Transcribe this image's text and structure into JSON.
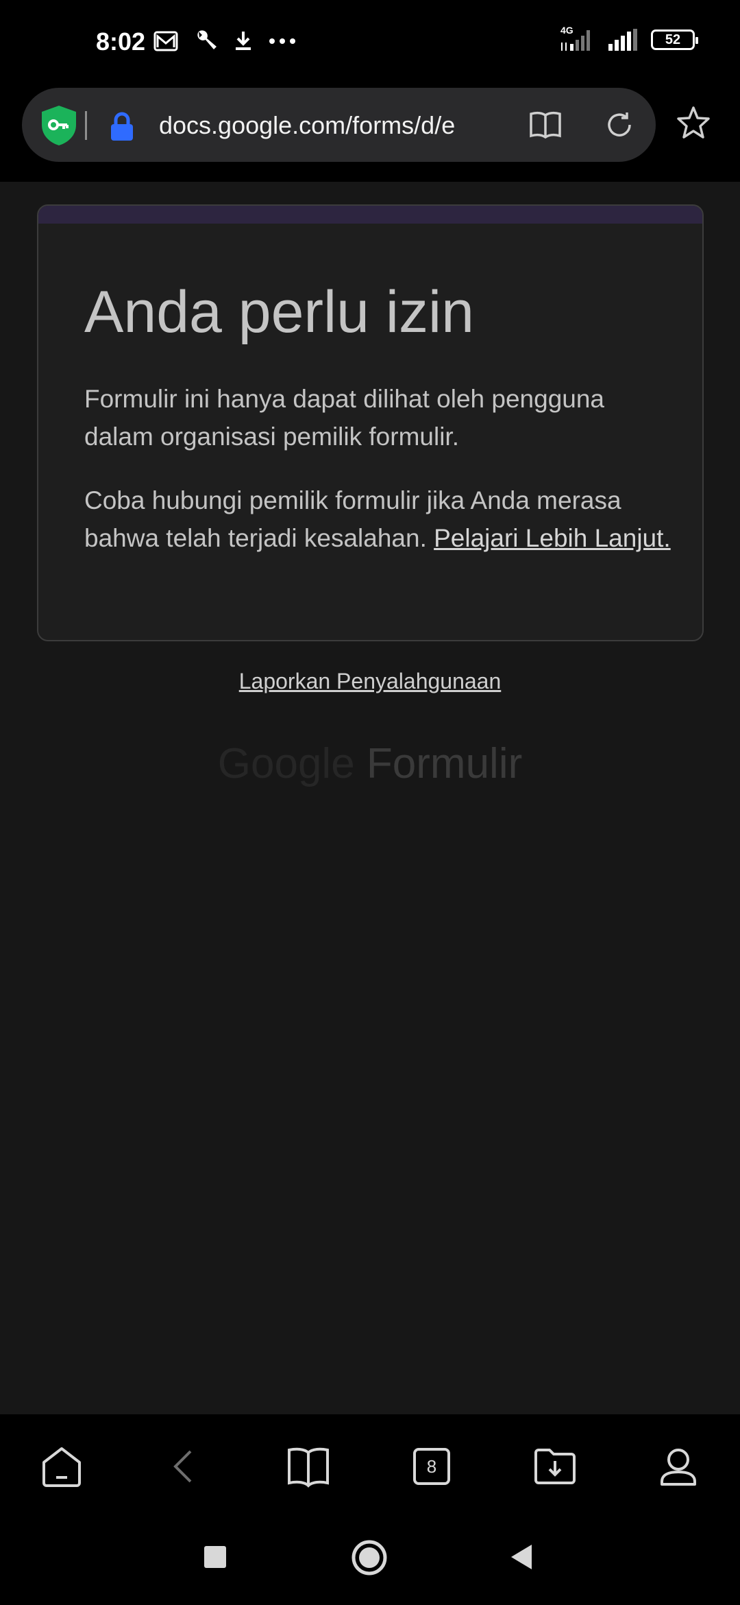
{
  "status_bar": {
    "time": "8:02",
    "network_label": "4G",
    "battery": "52"
  },
  "browser": {
    "url": "docs.google.com/forms/d/e"
  },
  "card": {
    "title": "Anda perlu izin",
    "paragraph1": "Formulir ini hanya dapat dilihat oleh pengguna dalam organisasi pemilik formulir.",
    "paragraph2": "Coba hubungi pemilik formulir jika Anda merasa bahwa telah terjadi kesalahan.",
    "learn_more": "Pelajari Lebih Lanjut."
  },
  "report_abuse": "Laporkan Penyalahgunaan",
  "brand": {
    "google": "Google",
    "product": "Formulir"
  },
  "bottom_nav": {
    "tab_count": "8"
  },
  "colors": {
    "background": "#171717",
    "card": "#1e1e1e",
    "accent": "#2d2540",
    "shield": "#1bb35a",
    "lock": "#2f6bff"
  }
}
